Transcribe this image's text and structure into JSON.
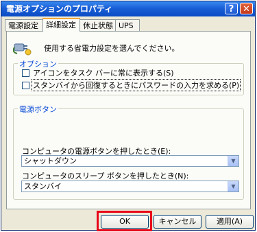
{
  "window": {
    "title": "電源オプションのプロパティ",
    "help_glyph": "?",
    "close_glyph": "✕"
  },
  "tabs": [
    {
      "label": "電源設定"
    },
    {
      "label": "詳細設定"
    },
    {
      "label": "休止状態"
    },
    {
      "label": "UPS"
    }
  ],
  "description": "使用する省電力設定を選んでください。",
  "options_group": {
    "title": "オプション",
    "items": [
      {
        "label": "アイコンをタスク バーに常に表示する(S)",
        "checked": false
      },
      {
        "label": "スタンバイから回復するときにパスワードの入力を求める(P)",
        "checked": false
      }
    ]
  },
  "power_buttons_group": {
    "title": "電源ボタン",
    "power_button_label": "コンピュータの電源ボタンを押したとき(E):",
    "power_button_value": "シャットダウン",
    "sleep_button_label": "コンピュータのスリープ ボタンを押したとき(N):",
    "sleep_button_value": "スタンバイ"
  },
  "buttons": {
    "ok": "OK",
    "cancel": "キャンセル",
    "apply": "適用(A)"
  },
  "colors": {
    "highlight": "#e8061a",
    "group_title": "#0046d5",
    "titlebar": "#0a4bc4"
  },
  "icons": {
    "power_options": "power-plug-icon",
    "dropdown": "chevron-down-icon"
  }
}
